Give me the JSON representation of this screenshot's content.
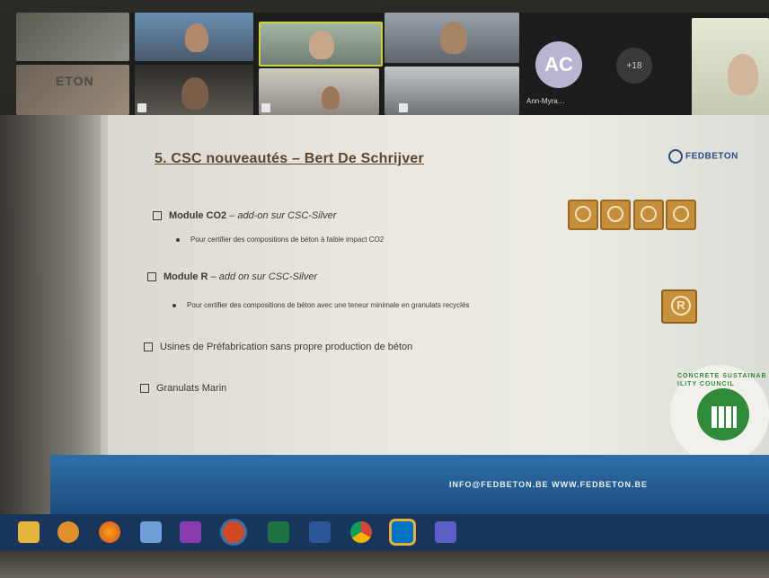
{
  "video_strip": {
    "tile_label_left": "ETON",
    "avatar_initials": "AC",
    "avatar_name": "Ann-Myra…",
    "more_count": "+18"
  },
  "slide": {
    "title": "5. CSC nouveautés – Bert De Schrijver",
    "logo_text": "FEDBETON",
    "items": [
      {
        "lead": "Module CO2",
        "rest": " – add-on sur CSC-Silver"
      },
      {
        "sub": "Pour certifier des compositions de béton à faible impact CO2"
      },
      {
        "lead": "Module R",
        "rest": " – add on sur CSC-Silver"
      },
      {
        "sub": "Pour certifier des compositions de béton avec une teneur minimale en granulats recyclés"
      },
      {
        "text": "Usines de Préfabrication sans propre production de béton"
      },
      {
        "text": "Granulats Marin"
      }
    ],
    "r_badge": "R",
    "seal_text": "CONCRETE SUSTAINABILITY COUNCIL",
    "footer": "INFO@FEDBETON.BE   WWW.FEDBETON.BE"
  },
  "colors": {
    "slide_title": "#5b4630",
    "footer_blue": "#2f6fa8",
    "badge_gold": "#c58f3a",
    "seal_green": "#2f8a3a"
  },
  "taskbar_icons": [
    "folder-icon",
    "media-player-icon",
    "firefox-icon",
    "network-icon",
    "onenote-icon",
    "powerpoint-icon",
    "excel-icon",
    "word-icon",
    "chrome-icon",
    "outlook-icon",
    "teams-icon"
  ]
}
